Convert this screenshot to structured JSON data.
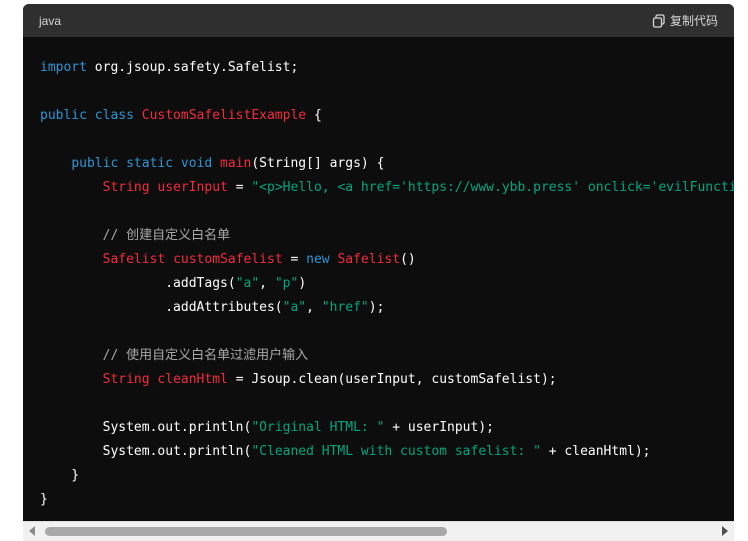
{
  "header": {
    "language": "java",
    "copy_label": "复制代码"
  },
  "code": {
    "l1": {
      "kw": "import",
      "rest": " org.jsoup.safety.Safelist;"
    },
    "l3": {
      "kw": "public class",
      "cls": "CustomSafelistExample",
      "rest": " {"
    },
    "l5": {
      "indent": "    ",
      "kw": "public static void",
      "cls": "main",
      "rest": "(String[] args) {"
    },
    "l6": {
      "indent": "        ",
      "cls1": "String",
      "cls2": "userInput",
      "eq": " = ",
      "str": "\"<p>Hello, <a href='https://www.ybb.press' onclick='evilFunction()'>Click me</a></p>\"",
      "end": ";"
    },
    "l8": {
      "indent": "        ",
      "cmt": "// 创建自定义白名单"
    },
    "l9": {
      "indent": "        ",
      "cls1": "Safelist",
      "cls2": "customSafelist",
      "eq": " = ",
      "kw": "new",
      "cls3": "Safelist",
      "end": "()"
    },
    "l10": {
      "indent": "                ",
      "a": ".addTags(",
      "s1": "\"a\"",
      "c": ", ",
      "s2": "\"p\"",
      "end": ")"
    },
    "l11": {
      "indent": "                ",
      "a": ".addAttributes(",
      "s1": "\"a\"",
      "c": ", ",
      "s2": "\"href\"",
      "end": ");"
    },
    "l13": {
      "indent": "        ",
      "cmt": "// 使用自定义白名单过滤用户输入"
    },
    "l14": {
      "indent": "        ",
      "cls1": "String",
      "cls2": "cleanHtml",
      "rest": " = Jsoup.clean(userInput, customSafelist);"
    },
    "l16": {
      "indent": "        ",
      "a": "System.out.println(",
      "str": "\"Original HTML: \"",
      "end": " + userInput);"
    },
    "l17": {
      "indent": "        ",
      "a": "System.out.println(",
      "str": "\"Cleaned HTML with custom safelist: \"",
      "end": " + cleanHtml);"
    },
    "l18": {
      "text": "    }"
    },
    "l19": {
      "text": "}"
    }
  },
  "colors": {
    "keyword": "#2e95d3",
    "class_name": "#f22c3d",
    "string": "#00a67d",
    "comment": "#a8a8a8",
    "background": "#0d0d0d",
    "header_bg": "#2f2f2f"
  }
}
